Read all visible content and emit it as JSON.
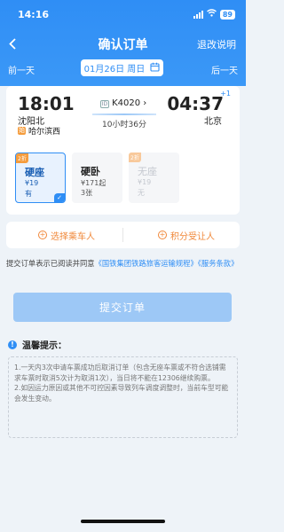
{
  "status_bar": {
    "time": "14:16",
    "battery": "89"
  },
  "nav": {
    "title": "确认订单",
    "right_link": "退改说明"
  },
  "date_bar": {
    "prev": "前一天",
    "date": "01月26日 周日",
    "next": "后一天"
  },
  "trip": {
    "depart_time": "18:01",
    "depart_station": "沈阳北",
    "depart_sub": "哈尔滨西",
    "arrive_time": "04:37",
    "arrive_plus": "+1",
    "arrive_station": "北京",
    "train_no": "K4020",
    "duration": "10小时36分"
  },
  "seats": [
    {
      "tag": "2折",
      "name": "硬座",
      "price": "¥19",
      "availability": "有",
      "selected": true
    },
    {
      "tag": "",
      "name": "硬卧",
      "price": "¥171起",
      "availability": "3张",
      "selected": false
    },
    {
      "tag": "2折",
      "name": "无座",
      "price": "¥19",
      "availability": "无",
      "selected": false,
      "disabled": true
    }
  ],
  "actions": {
    "select_passenger": "选择乘车人",
    "points_recipient": "积分受让人"
  },
  "agreement": {
    "prefix": "提交订单表示已阅读并同意",
    "link1": "《国铁集团铁路旅客运输规程》",
    "link2": "《服务条款》"
  },
  "submit_label": "提交订单",
  "tips": {
    "title": "温馨提示：",
    "items": [
      "1.一天内3次申请车票成功后取消订单（包含无座车票或不符合选铺需求车票时取消5次计为取消1次），当日将不能在12306继续购票。",
      "2.如因运力原因或其他不可控因素导致列车调度调整时，当前车型可能会发生变动。"
    ]
  }
}
